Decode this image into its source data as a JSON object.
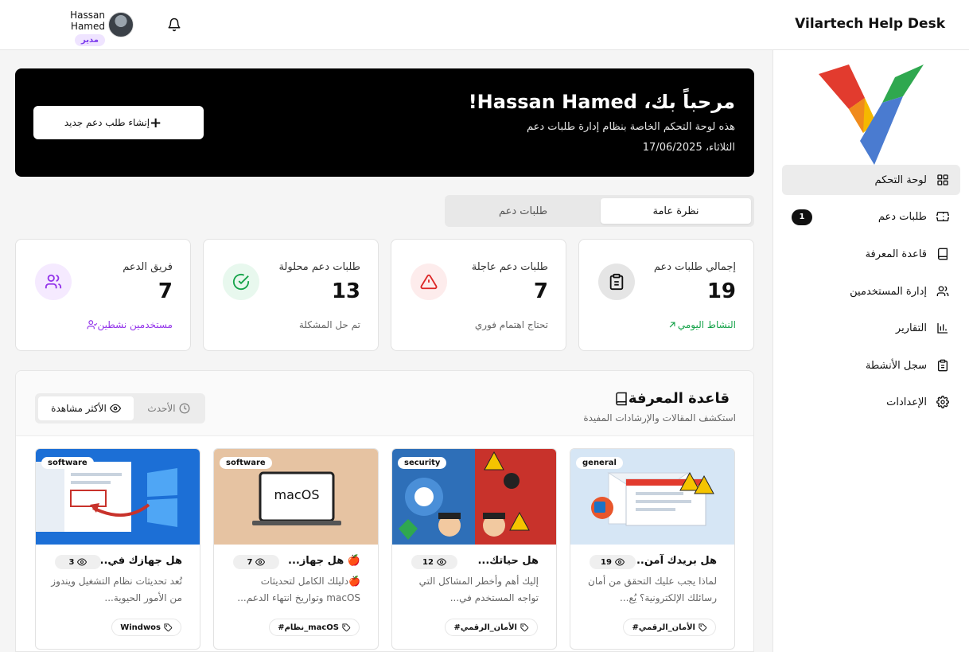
{
  "header": {
    "brand": "Vilartech Help Desk",
    "user_name": "Hassan Hamed",
    "role": "مدير"
  },
  "sidebar": {
    "items": [
      {
        "label": "لوحة التحكم",
        "icon": "grid-icon",
        "active": true
      },
      {
        "label": "طلبات دعم",
        "icon": "ticket-icon",
        "badge": "1"
      },
      {
        "label": "قاعدة المعرفة",
        "icon": "book-icon"
      },
      {
        "label": "إدارة المستخدمين",
        "icon": "users-icon"
      },
      {
        "label": "التقارير",
        "icon": "bar-chart-icon"
      },
      {
        "label": "سجل الأنشطة",
        "icon": "clipboard-icon"
      },
      {
        "label": "الإعدادات",
        "icon": "gear-icon"
      }
    ]
  },
  "hero": {
    "title": "مرحباً بك، Hassan Hamed!",
    "subtitle": "هذه لوحة التحكم الخاصة بنظام إدارة طلبات دعم",
    "date": "الثلاثاء، 17/06/2025",
    "new_ticket_label": "إنشاء طلب دعم جديد"
  },
  "tabs": {
    "overview": "نظرة عامة",
    "tickets": "طلبات دعم"
  },
  "stats": [
    {
      "title": "إجمالي طلبات دعم",
      "value": "19",
      "footer": "النشاط اليومي",
      "footer_color": "#16a34a",
      "icon": "clipboard-icon",
      "circle_color": "#e5e5e5",
      "icon_color": "#111111"
    },
    {
      "title": "طلبات دعم عاجلة",
      "value": "7",
      "footer": "تحتاج اهتمام فوري",
      "footer_color": "#666666",
      "icon": "alert-triangle-icon",
      "circle_color": "#fdecec",
      "icon_color": "#dc2626"
    },
    {
      "title": "طلبات دعم محلولة",
      "value": "13",
      "footer": "تم حل المشكلة",
      "footer_color": "#666666",
      "icon": "check-circle-icon",
      "circle_color": "#e8f8ee",
      "icon_color": "#16a34a"
    },
    {
      "title": "فريق الدعم",
      "value": "7",
      "footer": "مستخدمين نشطين",
      "footer_color": "#9333ea",
      "icon": "users-icon",
      "circle_color": "#f5eaff",
      "icon_color": "#9333ea"
    }
  ],
  "kb": {
    "title": "قاعدة المعرفة",
    "subtitle": "استكشف المقالات والإرشادات المفيدة",
    "latest": "الأحدث",
    "most_viewed": "الأكثر مشاهدة",
    "articles": [
      {
        "category": "general",
        "title": "هل بريدك آمن...",
        "views": "19",
        "desc": "لماذا يجب عليك التحقق من أمان رسائلك الإلكترونية؟ يُع...",
        "tag": "#الأمان_الرقمي"
      },
      {
        "category": "security",
        "title": "هل حياتك...",
        "views": "12",
        "desc": "إليك أهم وأخطر المشاكل التي تواجه المستخدم في...",
        "tag": "#الأمان_الرقمي"
      },
      {
        "category": "software",
        "title": "🍎 هل جهاز...",
        "views": "7",
        "desc": "🍎دليلك الكامل لتحديثات macOS وتواريخ انتهاء الدعم...",
        "tag": "#نظام_macOS",
        "image_text": "macOS"
      },
      {
        "category": "software",
        "title": "هل جهازك في...",
        "views": "3",
        "desc": "تُعد تحديثات نظام التشغيل ويندوز من الأمور الحيوية...",
        "tag": "Windwos"
      }
    ]
  },
  "colors": {
    "accent": "#000000",
    "purple": "#7c3aed",
    "green": "#16a34a",
    "red": "#dc2626"
  }
}
